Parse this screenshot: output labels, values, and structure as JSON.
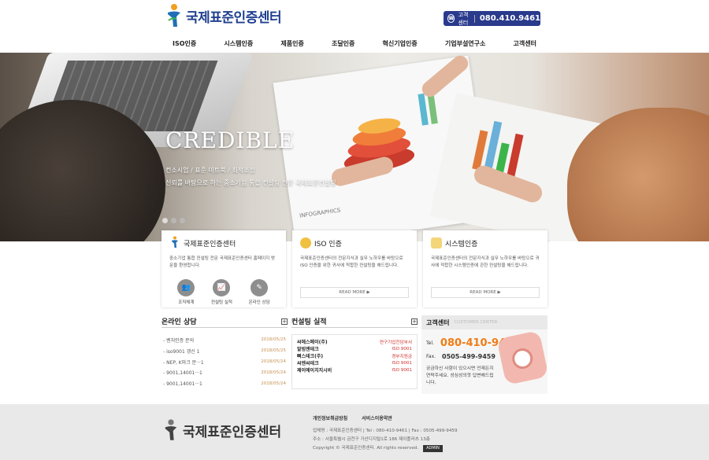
{
  "header": {
    "logo_text": "국제표준인증센터",
    "phone_label": "고객센터",
    "phone_number": "080.410.9461"
  },
  "nav": [
    "ISO인증",
    "시스템인증",
    "제품인증",
    "조달인증",
    "혁신기업인증",
    "기업부설연구소",
    "고객센터"
  ],
  "hero": {
    "title": "CREDIBLE",
    "sub1": "컨소시엄 / 표준 미트북 / 최적조정",
    "sub2": "신뢰를 바탕으로 하는 중소기업 통합 컨설팅 전문 국제표준컨설팅",
    "image_label": "INFOGRAPHICS"
  },
  "cards": [
    {
      "title": "국제표준인증센터",
      "desc": "중소기업 통합 컨설팅 전문 국제표준인증센터 홈페이지 방문을 환영합니다.",
      "links": [
        {
          "label": "조직체계",
          "icon": "people-icon"
        },
        {
          "label": "컨설팅 실적",
          "icon": "chart-icon"
        },
        {
          "label": "온라인 상담",
          "icon": "pencil-icon"
        }
      ]
    },
    {
      "title": "ISO 인증",
      "desc": "국제표준인증센터의 전문지식과 실무 노하우를 바탕으로 ISO 인증을 위한 귀사에 적합한 컨설팅을 해드립니다.",
      "button": "READ MORE ▶"
    },
    {
      "title": "시스템인증",
      "desc": "국제표준인증센터의 전문지식과 실무 노하우를 바탕으로 귀사에 적합한 시스템인증에 관한 컨설팅을 해드립니다.",
      "button": "READ MORE ▶"
    }
  ],
  "online": {
    "title": "온라인 상담",
    "posts": [
      {
        "title": "- 벤처인증 문의",
        "date": "2018/05/25"
      },
      {
        "title": "- iso9001 갱신 1",
        "date": "2018/05/25"
      },
      {
        "title": "- NEP, K마크 문···1",
        "date": "2018/05/24"
      },
      {
        "title": "- 9001,14001···1",
        "date": "2018/05/24"
      },
      {
        "title": "- 9001,14001···1",
        "date": "2018/05/24"
      }
    ]
  },
  "consulting": {
    "title": "컨설팅 실적",
    "rows": [
      {
        "name": "씨에스메이(주)",
        "tag": "연구기업전담부서"
      },
      {
        "name": "알빔앤테크",
        "tag": "ISO 9001"
      },
      {
        "name": "뼈스테크(주)",
        "tag": "경부지원금"
      },
      {
        "name": "씨엔씨테크",
        "tag": "ISO 9001"
      },
      {
        "name": "제이에이치지시비",
        "tag": "ISO 9001"
      }
    ]
  },
  "support": {
    "title": "고객센터",
    "subtitle": "CUSTOMER CENTER",
    "tel_label": "Tel.",
    "tel": "080-410-9461",
    "fax_label": "Fax.",
    "fax": "0505-499-9459",
    "desc": "궁금하신 사항이 있으시면 언제든지 연락주세요. 성심성의껏 답변해드립니다."
  },
  "footer": {
    "logo_text": "국제표준인증센터",
    "links": [
      "개인정보취급방침",
      "서비스이용약관"
    ],
    "line1": "업체명 : 국제표준인증센터  |  Tel : 080-410-9461  |  Fax : 0505-499-9459",
    "line2": "주소 : 서울특별시 금천구 가산디지털1로 186 제이플라츠 13층",
    "line3": "Copyright © 국제표준인증센터. All rights reserved.",
    "admin": "ADMIN"
  },
  "colors": {
    "brand_blue": "#2a3a8c",
    "accent_orange": "#f07c16",
    "tag_red": "#d0302a"
  }
}
